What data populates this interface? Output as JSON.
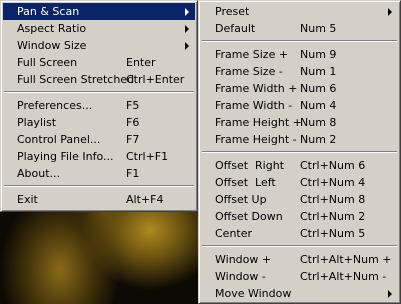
{
  "main_menu": {
    "group1": [
      {
        "label": "Pan & Scan",
        "accelerator": "",
        "submenu": true,
        "selected": true
      },
      {
        "label": "Aspect Ratio",
        "accelerator": "",
        "submenu": true
      },
      {
        "label": "Window Size",
        "accelerator": "",
        "submenu": true
      },
      {
        "label": "Full Screen",
        "accelerator": "Enter",
        "submenu": false
      },
      {
        "label": "Full Screen Stretched",
        "accelerator": "Ctrl+Enter",
        "submenu": false
      }
    ],
    "group2": [
      {
        "label": "Preferences...",
        "accelerator": "F5"
      },
      {
        "label": "Playlist",
        "accelerator": "F6"
      },
      {
        "label": "Control Panel...",
        "accelerator": "F7"
      },
      {
        "label": "Playing File Info...",
        "accelerator": "Ctrl+F1"
      },
      {
        "label": "About...",
        "accelerator": "F1"
      }
    ],
    "group3": [
      {
        "label": "Exit",
        "accelerator": "Alt+F4"
      }
    ]
  },
  "pan_scan_submenu": {
    "top": [
      {
        "label": "Preset",
        "accelerator": "",
        "submenu": true
      },
      {
        "label": "Default",
        "accelerator": "Num 5",
        "submenu": false
      }
    ],
    "frame": [
      {
        "label": "Frame Size +",
        "accelerator": "Num 9"
      },
      {
        "label": "Frame Size -",
        "accelerator": "Num 1"
      },
      {
        "label": "Frame Width +",
        "accelerator": "Num 6"
      },
      {
        "label": "Frame Width -",
        "accelerator": "Num 4"
      },
      {
        "label": "Frame Height +",
        "accelerator": "Num 8"
      },
      {
        "label": "Frame Height -",
        "accelerator": "Num 2"
      }
    ],
    "offset": [
      {
        "label": "Offset  Right",
        "accelerator": "Ctrl+Num 6"
      },
      {
        "label": "Offset  Left",
        "accelerator": "Ctrl+Num 4"
      },
      {
        "label": "Offset Up",
        "accelerator": "Ctrl+Num 8"
      },
      {
        "label": "Offset Down",
        "accelerator": "Ctrl+Num 2"
      },
      {
        "label": "Center",
        "accelerator": "Ctrl+Num 5"
      }
    ],
    "window": [
      {
        "label": "Window +",
        "accelerator": "Ctrl+Alt+Num +",
        "submenu": false
      },
      {
        "label": "Window -",
        "accelerator": "Ctrl+Alt+Num -",
        "submenu": false
      },
      {
        "label": "Move Window",
        "accelerator": "",
        "submenu": true
      }
    ]
  },
  "colors": {
    "menu_face": "#d4d0c8",
    "highlight": "#0a246a",
    "highlight_text": "#ffffff"
  }
}
